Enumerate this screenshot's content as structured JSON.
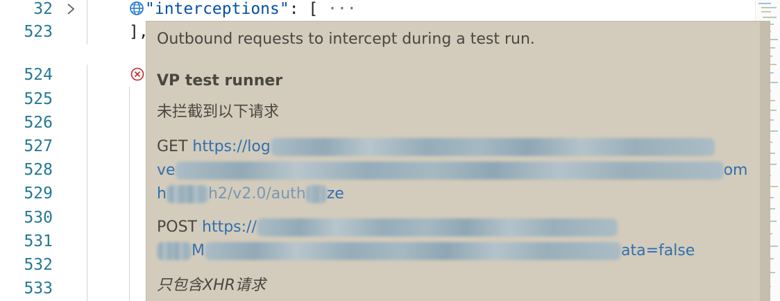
{
  "editor": {
    "line_numbers": [
      "32",
      "523",
      "524",
      "525",
      "526",
      "527",
      "528",
      "529",
      "530",
      "531",
      "532",
      "533"
    ],
    "line1": {
      "key": "\"interceptions\"",
      "colon": ": ",
      "bracket": "[",
      "ellipsis": "···"
    },
    "line2": {
      "text": "],"
    },
    "icons": {
      "fold": "chevron-right-icon",
      "globe": "globe-icon",
      "error": "error-circle-icon"
    }
  },
  "hover": {
    "description": "Outbound requests to intercept during a test run.",
    "title": "VP test runner",
    "subtitle": "未拦截到以下请求",
    "get_method": "GET",
    "get_url_part1": "https://log",
    "get_url_part2_prefix": "ve",
    "get_url_part2_suffix": "om",
    "get_url_part3_prefix": "h",
    "get_url_part3_mid": "h2/v2.0/auth",
    "get_url_part3_suffix": "ze",
    "post_method": "POST",
    "post_url_part1": "https://",
    "post_url_part2_prefix": "M",
    "post_url_part2_suffix": "ata=false",
    "footer": "只包含XHR请求"
  },
  "colors": {
    "line_number": "#237893",
    "json_key": "#0451a5",
    "hover_background": "#d3cbbb",
    "link": "#2f6fb0",
    "error_icon": "#c62828"
  }
}
